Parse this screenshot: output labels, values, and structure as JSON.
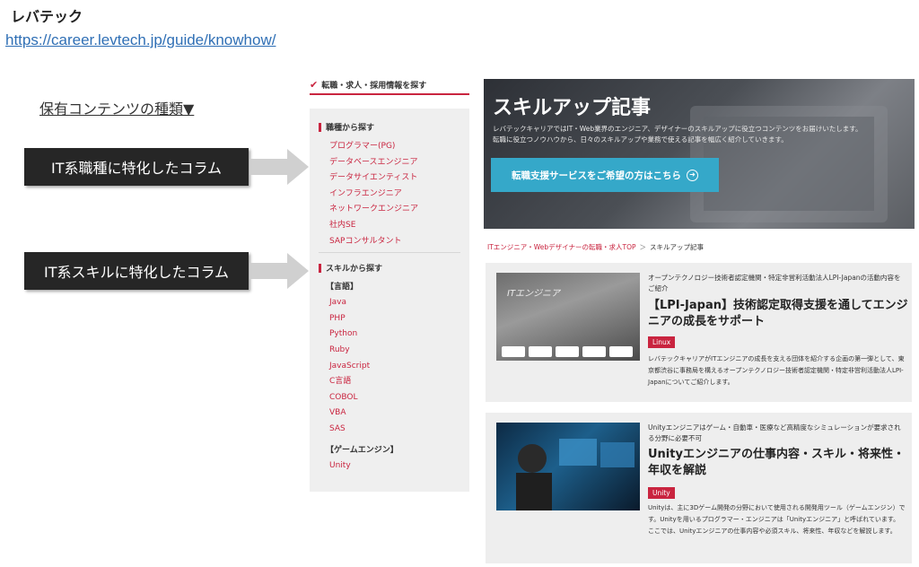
{
  "brand": "レバテック",
  "url": "https://career.levtech.jp/guide/knowhow/",
  "contents_heading": "保有コンテンツの種類▼",
  "callouts": {
    "it_jobs": "IT系職種に特化したコラム",
    "it_skills": "IT系スキルに特化したコラム"
  },
  "sidebar": {
    "top_title": "転職・求人・採用情報を探す",
    "job_section": "職種から探す",
    "job_links": [
      "プログラマー(PG)",
      "データベースエンジニア",
      "データサイエンティスト",
      "インフラエンジニア",
      "ネットワークエンジニア",
      "社内SE",
      "SAPコンサルタント"
    ],
    "skill_section": "スキルから探す",
    "language_label": "【言語】",
    "language_links": [
      "Java",
      "PHP",
      "Python",
      "Ruby",
      "JavaScript",
      "C言語",
      "COBOL",
      "VBA",
      "SAS"
    ],
    "engine_label": "【ゲームエンジン】",
    "engine_links": [
      "Unity"
    ]
  },
  "hero": {
    "title": "スキルアップ記事",
    "text_line1": "レバテックキャリアではIT・Web業界のエンジニア、デザイナーのスキルアップに役立つコンテンツをお届けいたします。",
    "text_line2": "転職に役立つノウハウから、日々のスキルアップや業務で使える記事を幅広く紹介していきます。",
    "button_label": "転職支援サービスをご希望の方はこちら"
  },
  "breadcrumb": {
    "home": "ITエンジニア・Webデザイナーの転職・求人TOP",
    "separator": "＞",
    "current": "スキルアップ記事"
  },
  "articles": [
    {
      "lead": "オープンテクノロジー技術者認定機関・特定非営利活動法人LPI-Japanの活動内容をご紹介",
      "title": "【LPI-Japan】技術認定取得支援を通してエンジニアの成長をサポート",
      "tag": "Linux",
      "thumb_text": "ITエンジニア",
      "description": "レバテックキャリアがITエンジニアの成長を支える団体を紹介する企画の第一弾として、東京都渋谷に事務局を構えるオープンテクノロジー技術者認定機関・特定非営利活動法人LPI-Japanについてご紹介します。"
    },
    {
      "lead": "Unityエンジニアはゲーム・自動車・医療など高精度なシミュレーションが要求される分野に必要不可",
      "title": "Unityエンジニアの仕事内容・スキル・将来性・年収を解説",
      "tag": "Unity",
      "description": "Unityは、主に3Dゲーム開発の分野において使用される開発用ツール（ゲームエンジン）です。Unityを用いるプログラマー・エンジニアは「Unityエンジニア」と呼ばれています。ここでは、Unityエンジニアの仕事内容や必須スキル、将来性、年収などを解説します。"
    }
  ],
  "colors": {
    "accent": "#c9243f",
    "link": "#2f6fb5",
    "cta": "#35a8c9",
    "callout_bg": "#262626"
  }
}
